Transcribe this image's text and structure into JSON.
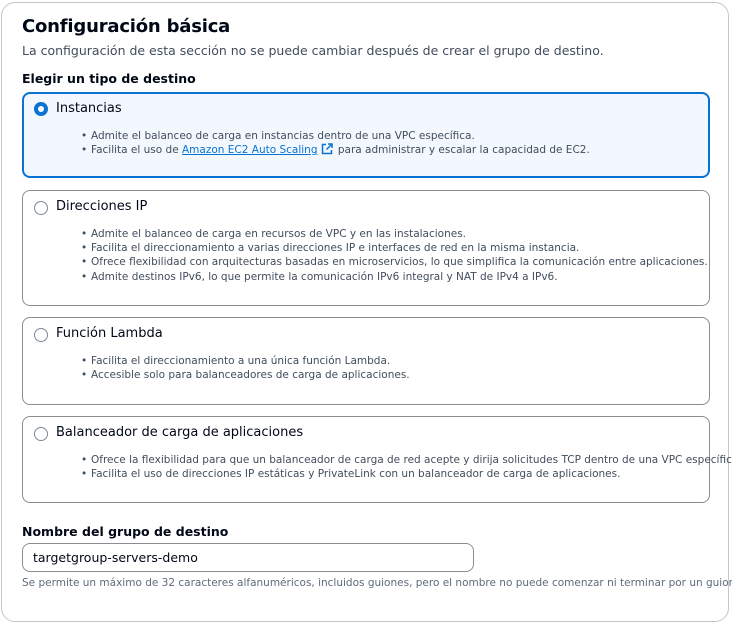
{
  "section": {
    "title": "Configuración básica",
    "description": "La configuración de esta sección no se puede cambiar después de crear el grupo de destino."
  },
  "target_type": {
    "label": "Elegir un tipo de destino",
    "selected": "instancias",
    "options": [
      {
        "label": "Instancias",
        "bullet1": "Admite el balanceo de carga en instancias dentro de una VPC específica.",
        "bullet2_prefix": "Facilita el uso de",
        "bullet2_link": "Amazon EC2 Auto Scaling",
        "bullet2_suffix": "para administrar y escalar la capacidad de EC2."
      },
      {
        "label": "Direcciones IP",
        "bullets": [
          "Admite el balanceo de carga en recursos de VPC y en las instalaciones.",
          "Facilita el direccionamiento a varias direcciones IP e interfaces de red en la misma instancia.",
          "Ofrece flexibilidad con arquitecturas basadas en microservicios, lo que simplifica la comunicación entre aplicaciones.",
          "Admite destinos IPv6, lo que permite la comunicación IPv6 integral y NAT de IPv4 a IPv6."
        ]
      },
      {
        "label": "Función Lambda",
        "bullets": [
          "Facilita el direccionamiento a una única función Lambda.",
          "Accesible solo para balanceadores de carga de aplicaciones."
        ]
      },
      {
        "label": "Balanceador de carga de aplicaciones",
        "bullets": [
          "Ofrece la flexibilidad para que un balanceador de carga de red acepte y dirija solicitudes TCP dentro de una VPC específica.",
          "Facilita el uso de direcciones IP estáticas y PrivateLink con un balanceador de carga de aplicaciones."
        ]
      }
    ]
  },
  "target_group_name": {
    "label": "Nombre del grupo de destino",
    "value": "targetgroup-servers-demo",
    "hint": "Se permite un máximo de 32 caracteres alfanuméricos, incluidos guiones, pero el nombre no puede comenzar ni terminar por un guion."
  },
  "colors": {
    "accent": "#0972d3",
    "selected_bg": "#f2f8fd",
    "border": "#8c8c94",
    "text": "#000716",
    "secondary_text": "#414d5c"
  },
  "icons": {
    "external_link": "external-link-icon"
  }
}
